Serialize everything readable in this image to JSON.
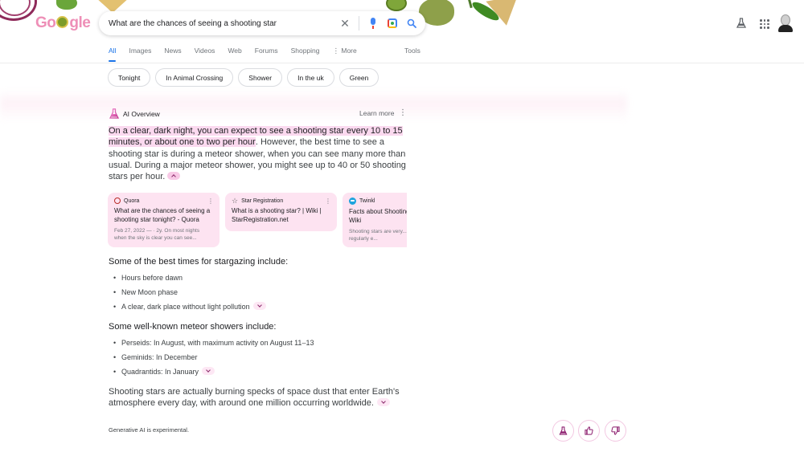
{
  "header": {
    "logo_text": "Google",
    "search": {
      "query": "What are the chances of seeing a shooting star",
      "icons": [
        "clear-icon",
        "microphone-icon",
        "google-lens-icon",
        "search-icon"
      ]
    },
    "right_icons": [
      "labs-flask-icon",
      "apps-grid-icon",
      "account-avatar"
    ]
  },
  "tabs": {
    "items": [
      {
        "label": "All",
        "active": true
      },
      {
        "label": "Images",
        "active": false
      },
      {
        "label": "News",
        "active": false
      },
      {
        "label": "Videos",
        "active": false
      },
      {
        "label": "Web",
        "active": false
      },
      {
        "label": "Forums",
        "active": false
      },
      {
        "label": "Shopping",
        "active": false
      },
      {
        "label": "⋮ More",
        "active": false
      }
    ],
    "tools_label": "Tools"
  },
  "chips": [
    "Tonight",
    "In Animal Crossing",
    "Shower",
    "In the uk",
    "Green"
  ],
  "ai_overview": {
    "label": "AI Overview",
    "learn_more": "Learn more",
    "highlight": "On a clear, dark night, you can expect to see a shooting star every 10 to 15 minutes, or about one to two per hour",
    "body": ". However, the best time to see a shooting star is during a meteor shower, when you can see many more than usual. During a major meteor shower, you might see up to 40 or 50 shooting stars per hour.",
    "sources": [
      {
        "site": "Quora",
        "title": "What are the chances of seeing a shooting star tonight? - Quora",
        "snippet": "Feb 27, 2022 — · 2y. On most nights when the sky is clear you can see..."
      },
      {
        "site": "Star Registration",
        "title": "What is a shooting star? | Wiki | StarRegistration.net",
        "snippet": ""
      },
      {
        "site": "Twinkl",
        "title": "Facts about Shooting Stars - Twinkl Wiki",
        "snippet": "Shooting stars are very... from space regularly e..."
      }
    ],
    "stargazing": {
      "heading": "Some of the best times for stargazing include:",
      "items": [
        "Hours before dawn",
        "New Moon phase",
        "A clear, dark place without light pollution"
      ]
    },
    "showers": {
      "heading": "Some well-known meteor showers include:",
      "items": [
        "Perseids: In August, with maximum activity on August 11–13",
        "Geminids: In December",
        "Quadrantids: In January"
      ]
    },
    "final": "Shooting stars are actually burning specks of space dust that enter Earth's atmosphere every day, with around one million occurring worldwide.",
    "disclaimer": "Generative AI is experimental.",
    "feedback_buttons": [
      "labs-icon",
      "thumbs-up-icon",
      "thumbs-down-icon"
    ]
  },
  "colors": {
    "accent_blue": "#1a73e8",
    "highlight_pink": "#fbd9ef",
    "card_pink": "#fde3f1",
    "ai_purple": "#8c1d6e"
  }
}
